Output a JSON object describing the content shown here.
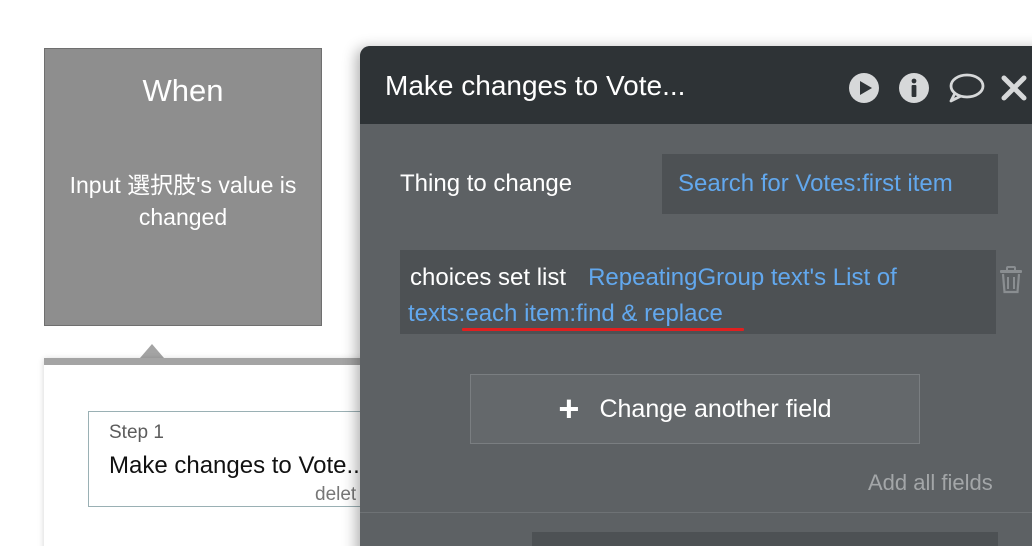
{
  "when_card": {
    "title": "When",
    "description_line1": "Input 選択肢's value is",
    "description_line2": "changed"
  },
  "step": {
    "label": "Step 1",
    "name": "Make changes to Vote...",
    "delete_label": "delet"
  },
  "panel": {
    "title": "Make changes to Vote...",
    "icons": [
      "play-icon",
      "info-icon",
      "comment-icon",
      "close-icon"
    ],
    "thing_to_change": {
      "label": "Thing to change",
      "value": "Search for Votes:first item"
    },
    "field": {
      "key": "choices set list",
      "expression_line1": "RepeatingGroup text's List of",
      "expression_line2": "texts:each item:find & replace",
      "highlighted_text": "each item:find & replace"
    },
    "change_button_label": "Change another field",
    "add_all_label": "Add all fields"
  },
  "colors": {
    "panel_bg": "#5d6164",
    "header_bg": "#2e3336",
    "field_bg": "#4d5154",
    "link_blue": "#62a8ee",
    "highlight_red": "#e02020",
    "when_card_bg": "#8e8e8e"
  }
}
